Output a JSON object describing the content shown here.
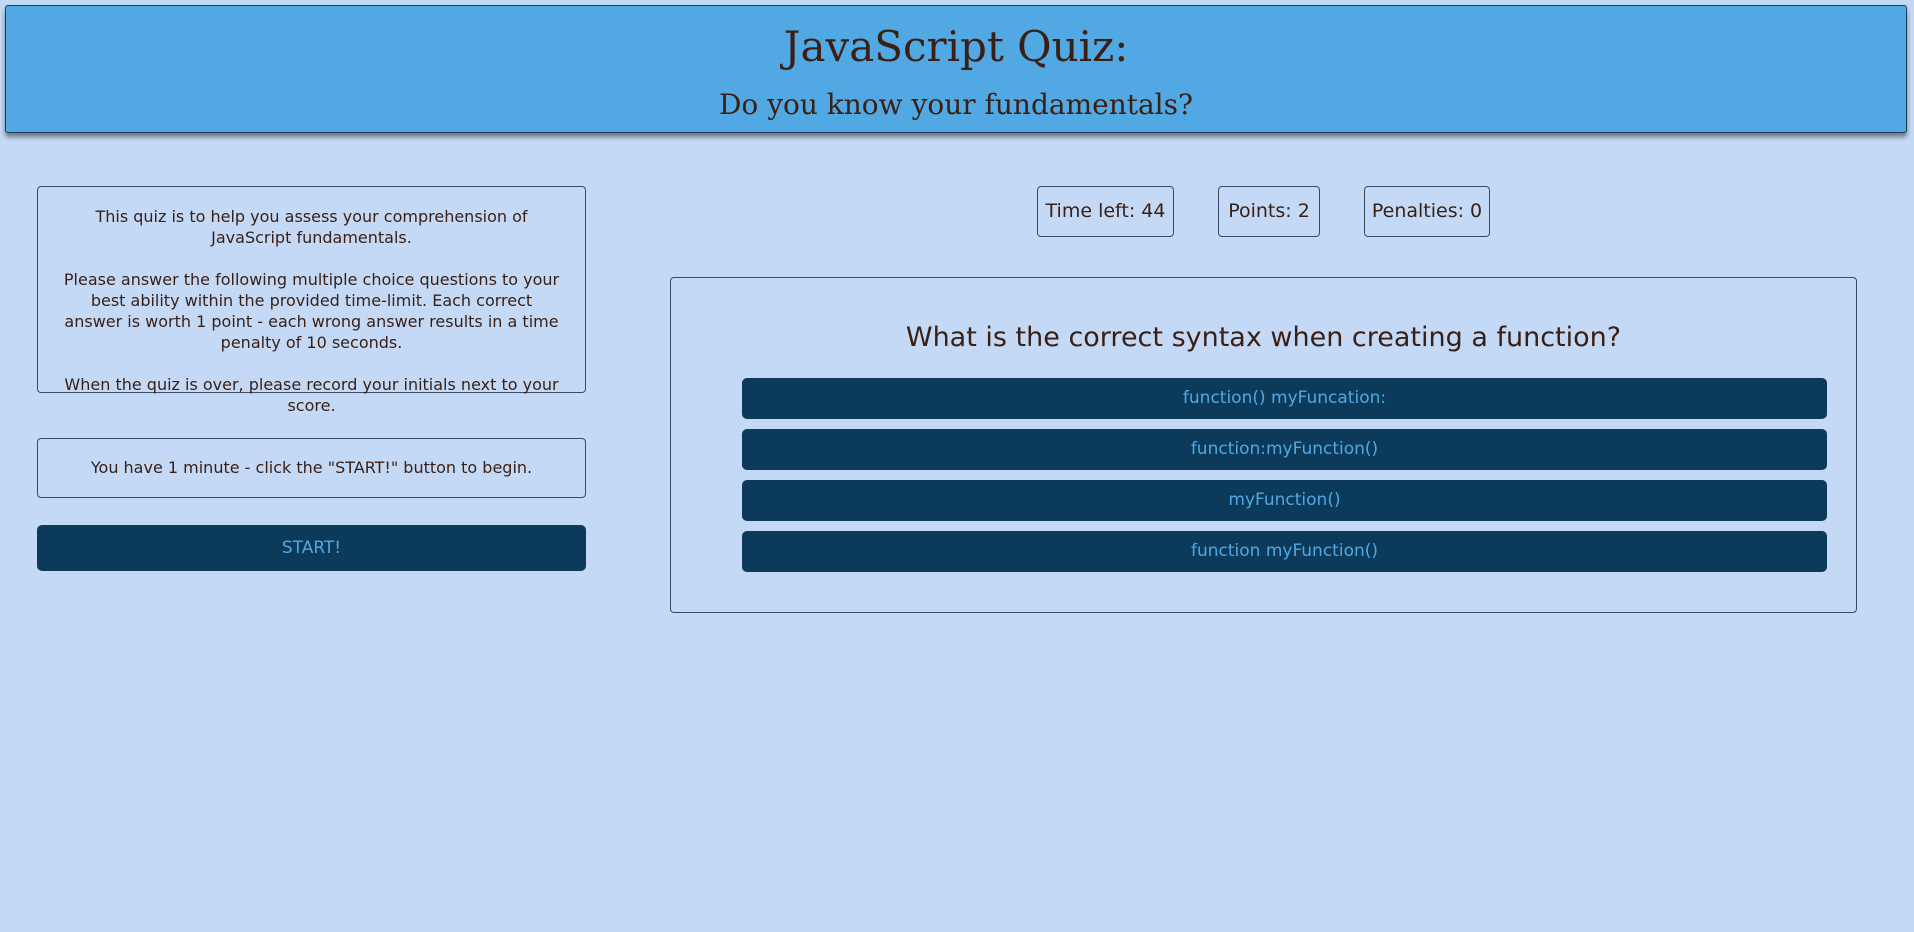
{
  "header": {
    "title": "JavaScript Quiz:",
    "subtitle": "Do you know your fundamentals?"
  },
  "intro": {
    "paragraph1": "This quiz is to help you assess your comprehension of JavaScript fundamentals.",
    "paragraph2": "Please answer the following multiple choice questions to your best ability within the provided time-limit. Each correct answer is worth 1 point - each wrong answer results in a time penalty of 10 seconds.",
    "paragraph3": "When the quiz is over, please record your initials next to your score."
  },
  "notice": "You have 1 minute - click the \"START!\" button to begin.",
  "start_label": "START!",
  "stats": {
    "time_left": "Time left: 44",
    "points": "Points: 2",
    "penalties": "Penalties: 0"
  },
  "question": {
    "text": "What is the correct syntax when creating a function?",
    "answers": [
      "function() myFuncation:",
      "function:myFunction()",
      "myFunction()",
      "function myFunction()"
    ]
  },
  "colors": {
    "background": "#c3d9f5",
    "header": "#52a8e2",
    "button": "#0c3a5a",
    "button_text": "#52a8e2",
    "text": "#3a1f14"
  }
}
